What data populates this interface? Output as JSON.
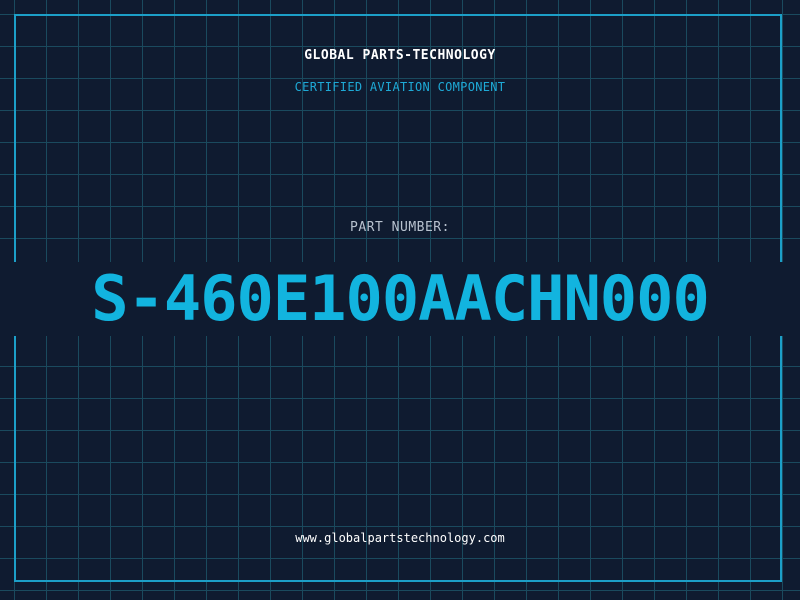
{
  "header": {
    "company": "GLOBAL PARTS-TECHNOLOGY",
    "subtitle": "CERTIFIED AVIATION COMPONENT"
  },
  "part": {
    "label": "PART NUMBER:",
    "number": "S-460E100AACHN000"
  },
  "footer": {
    "url": "www.globalpartstechnology.com"
  },
  "colors": {
    "background": "#0f1b30",
    "grid": "#1a4a5e",
    "frame": "#1c9fc8",
    "accent": "#12b4df",
    "label": "#b8c2cf",
    "text": "#ffffff"
  }
}
